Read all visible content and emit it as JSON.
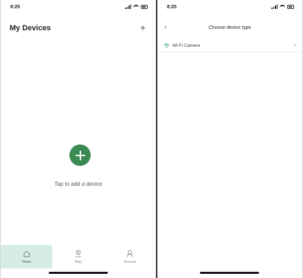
{
  "left_screen": {
    "status_time": "8:25",
    "title": "My Devices",
    "add_button": "+",
    "empty_state": {
      "caption": "Tap to add a device"
    },
    "tabs": [
      {
        "label": "Home",
        "icon": "home-icon",
        "active": true
      },
      {
        "label": "Map",
        "icon": "map-icon",
        "active": false
      },
      {
        "label": "Account",
        "icon": "account-icon",
        "active": false
      }
    ]
  },
  "right_screen": {
    "status_time": "8:25",
    "back": "‹",
    "title": "Choose device type",
    "device_types": [
      {
        "label": "Wi-Fi Camera",
        "icon": "wifi-icon",
        "chevron": "›"
      }
    ]
  },
  "colors": {
    "accent_green": "#3a8a52",
    "active_tab_bg": "#d6ede3"
  }
}
